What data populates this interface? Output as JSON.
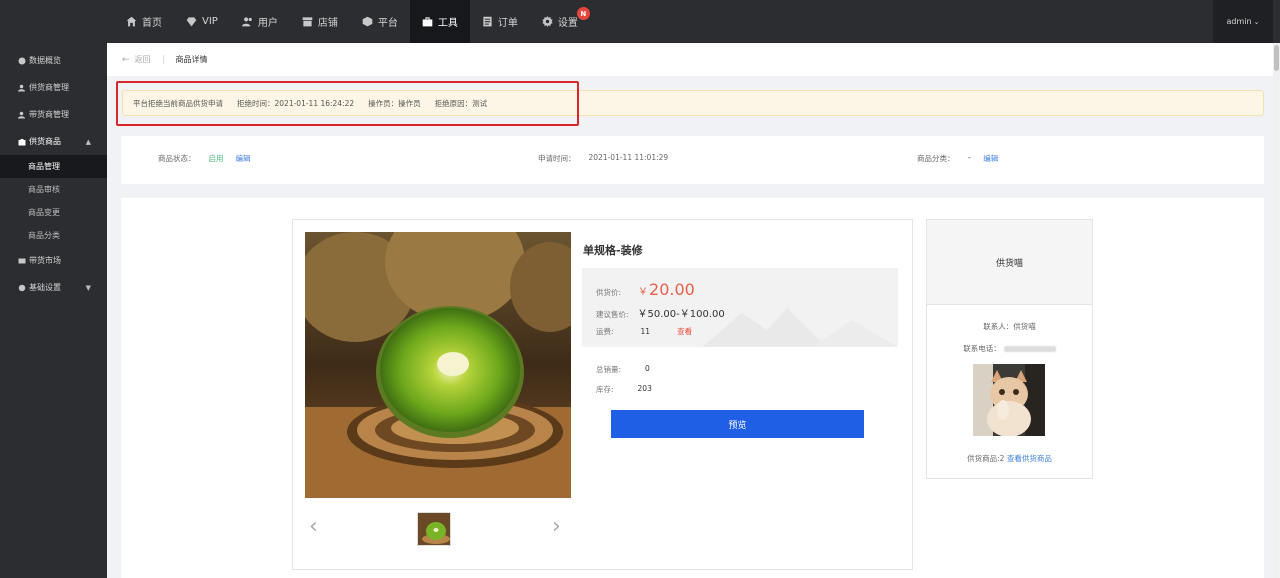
{
  "topnav": {
    "items": [
      {
        "label": "首页",
        "icon": "home-icon"
      },
      {
        "label": "VIP",
        "icon": "diamond-icon"
      },
      {
        "label": "用户",
        "icon": "users-icon"
      },
      {
        "label": "店铺",
        "icon": "store-icon"
      },
      {
        "label": "平台",
        "icon": "cube-icon"
      },
      {
        "label": "工具",
        "icon": "toolbox-icon",
        "active": true
      },
      {
        "label": "订单",
        "icon": "order-icon"
      },
      {
        "label": "设置",
        "icon": "gear-icon",
        "badge": "N"
      }
    ],
    "user": "admin"
  },
  "sidebar": {
    "items": [
      {
        "label": "数据概览"
      },
      {
        "label": "供货商管理"
      },
      {
        "label": "带货商管理"
      },
      {
        "label": "供货商品",
        "open": true,
        "caret": "▲"
      },
      {
        "label": "带货市场"
      },
      {
        "label": "基础设置",
        "caret": "▼"
      }
    ],
    "sub_items": [
      {
        "label": "商品管理",
        "active": true
      },
      {
        "label": "商品审核"
      },
      {
        "label": "商品变更"
      },
      {
        "label": "商品分类"
      }
    ]
  },
  "breadcrumb": {
    "back_label": "返回",
    "current": "商品详情"
  },
  "alert": {
    "message": "平台拒绝当前商品供货申请",
    "reject_time": "拒绝时间：2021-01-11 16:24:22",
    "operator": "操作员：操作员",
    "reason": "拒绝原因：测试"
  },
  "info": {
    "status_label": "商品状态：",
    "status_value": "启用",
    "status_edit": "编辑",
    "apply_time_label": "申请时间：",
    "apply_time_value": "2021-01-11 11:01:29",
    "category_label": "商品分类：",
    "category_value": "–",
    "category_edit": "编辑"
  },
  "product": {
    "title": "单规格-装修",
    "supply_price_label": "供货价:",
    "supply_price_symbol": "￥",
    "supply_price": "20.00",
    "suggested_label": "建议售价:",
    "suggested_price": "￥50.00-￥100.00",
    "shipping_label": "运费:",
    "shipping_value": "11",
    "shipping_link": "查看",
    "sales_label": "总销量:",
    "sales_value": "0",
    "stock_label": "库存:",
    "stock_value": "203",
    "preview_button": "预览"
  },
  "supplier": {
    "name": "供货喵",
    "contact": "联系人：供货喵",
    "phone_label": "联系电话：",
    "goods_count": "供货商品:2",
    "view_goods_link": "查看供货商品"
  },
  "colors": {
    "accent_blue": "#1f5fe6",
    "price_red": "#e8604c",
    "status_green": "#4ab77a",
    "alert_bg": "#fdf6e6",
    "highlight_red": "#d9252b"
  }
}
